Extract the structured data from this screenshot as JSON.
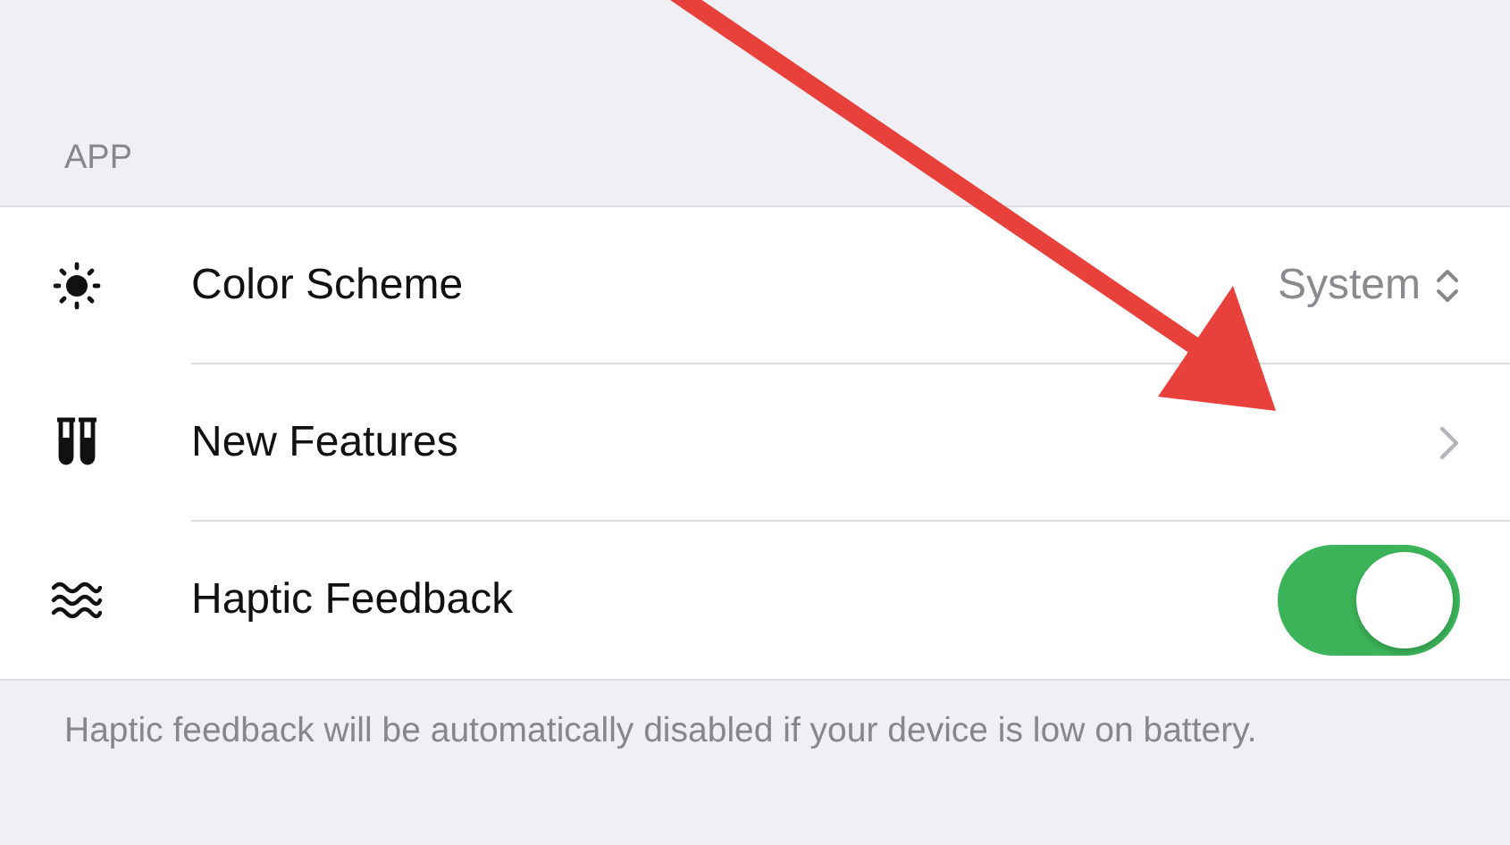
{
  "section_header": "APP",
  "rows": [
    {
      "kind": "value",
      "label": "Color Scheme",
      "value": "System"
    },
    {
      "kind": "link",
      "label": "New Features"
    },
    {
      "kind": "toggle",
      "label": "Haptic Feedback",
      "on": true
    }
  ],
  "footer": "Haptic feedback will be automatically disabled if your device is low on battery."
}
